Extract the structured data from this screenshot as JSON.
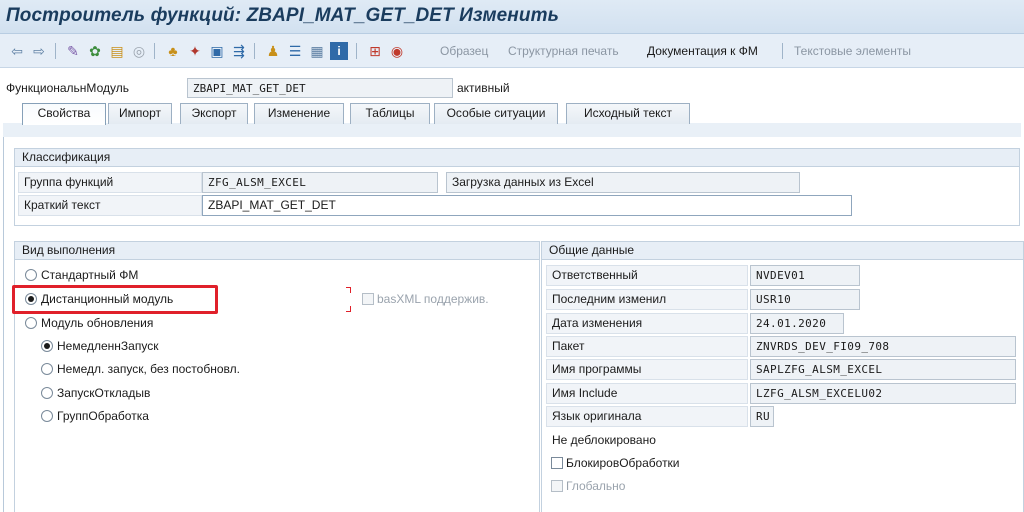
{
  "title": "Построитель функций: ZBAPI_MAT_GET_DET Изменить",
  "toolbar": {
    "icons": [
      "back-arrow-icon",
      "forward-arrow-icon",
      "other-object-icon",
      "display-change-icon",
      "active-inactive-icon",
      "where-used-icon",
      "check-icon",
      "activate-icon",
      "test-icon",
      "pretty-printer-icon",
      "hierarchy-icon",
      "object-list-icon",
      "display-object-list-icon",
      "info-icon",
      "function-module-icon",
      "breakpoint-icon"
    ],
    "pattern": "Образец",
    "pretty_print": "Структурная печать",
    "fm_docs": "Документация к ФМ",
    "text_elements": "Текстовые элементы"
  },
  "header": {
    "label": "ФункциональнМодуль",
    "value": "ZBAPI_MAT_GET_DET",
    "status": "активный"
  },
  "tabs": [
    "Свойства",
    "Импорт",
    "Экспорт",
    "Изменение",
    "Таблицы",
    "Особые ситуации",
    "Исходный текст"
  ],
  "classification": {
    "title": "Классификация",
    "group_label": "Группа функций",
    "group_value": "ZFG_ALSM_EXCEL",
    "group_desc": "Загрузка данных из Excel",
    "short_text_label": "Краткий текст",
    "short_text_value": "ZBAPI_MAT_GET_DET"
  },
  "execution": {
    "title": "Вид выполнения",
    "standard": "Стандартный ФМ",
    "remote": "Дистанционный модуль",
    "basxml": "basXML поддержив.",
    "update": "Модуль обновления",
    "immediate": "НемедленнЗапуск",
    "immediate_no_post": "Немедл. запуск, без постобновл.",
    "delayed": "ЗапускОткладыв",
    "collective": "ГруппОбработка",
    "selected": "remote"
  },
  "general": {
    "title": "Общие данные",
    "responsible_label": "Ответственный",
    "responsible_value": "NVDEV01",
    "last_changed_label": "Последним изменил",
    "last_changed_value": "USR10",
    "date_label": "Дата изменения",
    "date_value": "24.01.2020",
    "package_label": "Пакет",
    "package_value": "ZNVRDS_DEV_FI09_708",
    "program_label": "Имя программы",
    "program_value": "SAPLZFG_ALSM_EXCEL",
    "include_label": "Имя Include",
    "include_value": "LZFG_ALSM_EXCELU02",
    "lang_label": "Язык оригинала",
    "lang_value": "RU",
    "not_released": "Не деблокировано",
    "edit_lock": "БлокировОбработки",
    "global": "Глобально"
  },
  "colors": {
    "title_text": "#1a3c5e",
    "highlight": "#e0202a",
    "group_header_bg": "#e7eef6"
  }
}
